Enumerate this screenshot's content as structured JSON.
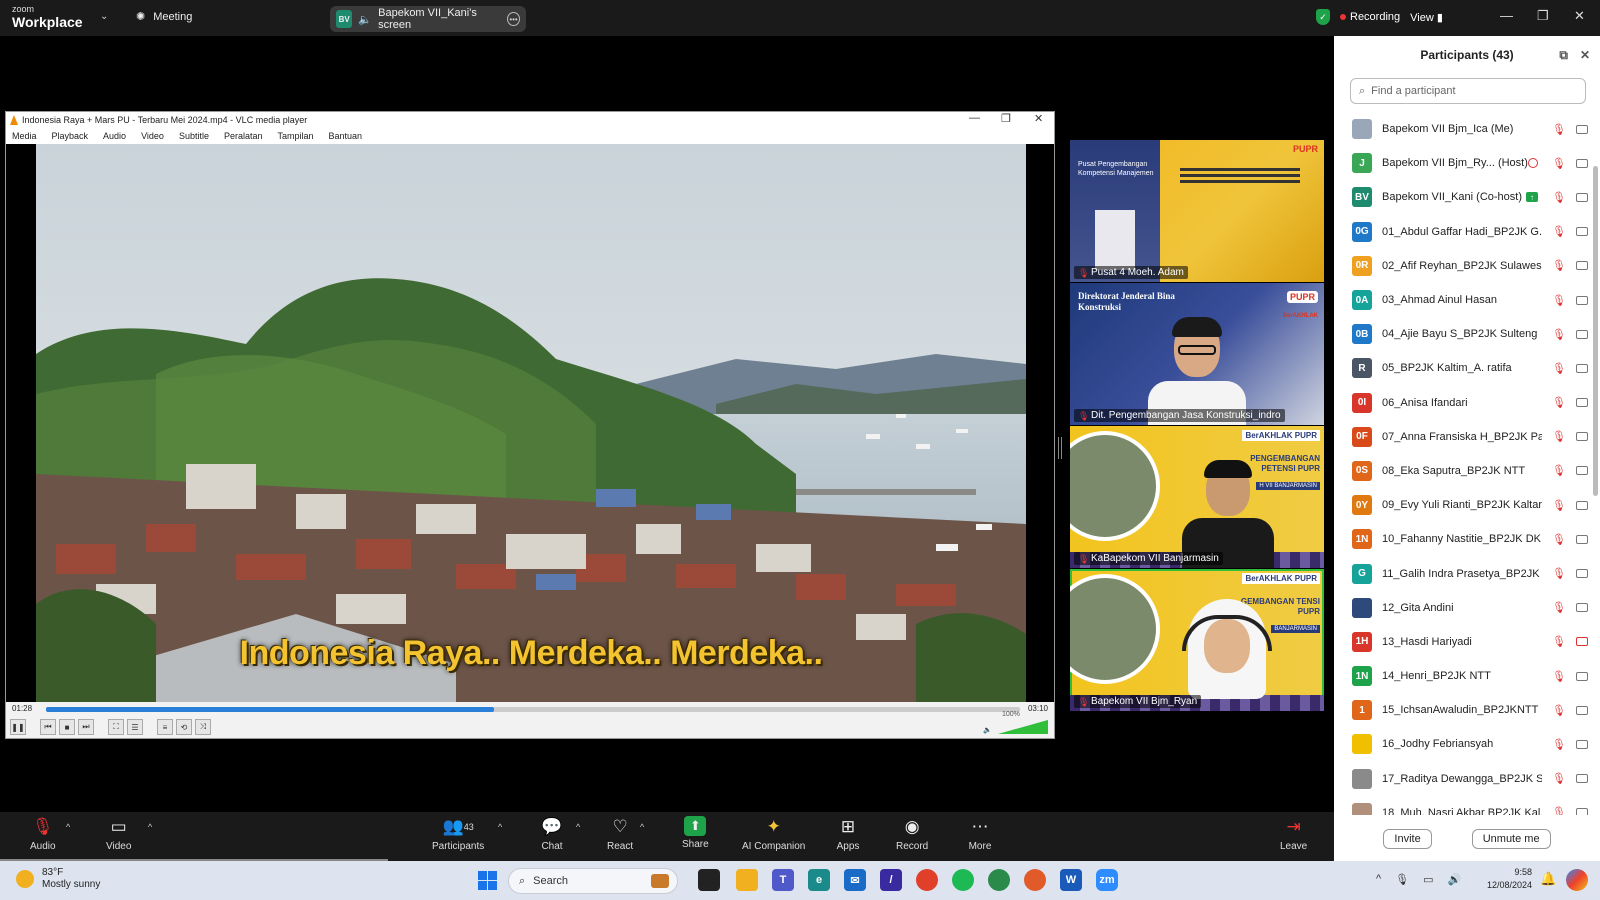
{
  "zoom": {
    "brand_top": "zoom",
    "brand_main": "Workplace",
    "meeting_label": "Meeting",
    "share_badge": "BV",
    "share_label": "Bapekom VII_Kani's screen",
    "recording_label": "Recording",
    "view_label": "View"
  },
  "vlc": {
    "title": "Indonesia Raya + Mars PU - Terbaru Mei 2024.mp4 - VLC media player",
    "menu": [
      "Media",
      "Playback",
      "Audio",
      "Video",
      "Subtitle",
      "Peralatan",
      "Tampilan",
      "Bantuan"
    ],
    "subtitle": "Indonesia Raya.. Merdeka.. Merdeka..",
    "time_current": "01:28",
    "time_total": "03:10",
    "progress": 0.46,
    "volume_label": "100%",
    "volume": 1.0
  },
  "tiles": [
    {
      "name": "Pusat 4 Moeh. Adam",
      "overlay": "Pusat Pengembangan Kompetensi Manajemen",
      "brand": "PUPR"
    },
    {
      "name": "Dit. Pengembangan Jasa Konstruksi_indro",
      "overlay": "Direktorat Jenderal Bina Konstruksi",
      "brand": "PUPR",
      "sub": "BerAKHLAK"
    },
    {
      "name": "KaBapekom VII Banjarmasin",
      "overlay": "PENGEMBANGAN PETENSI PUPR",
      "brand": "BerAKHLAK PUPR",
      "sub": "H VII BANJARMASIN"
    },
    {
      "name": "Bapekom VII Bjm_Ryan",
      "overlay": "GEMBANGAN TENSI PUPR",
      "brand": "BerAKHLAK PUPR",
      "sub": "BANJARMASIN"
    }
  ],
  "panel": {
    "title": "Participants (43)",
    "search_placeholder": "Find a participant",
    "invite": "Invite",
    "unmute_me": "Unmute me",
    "participants": [
      {
        "initials": "",
        "name": "Bapekom VII Bjm_Ica (Me)",
        "color": "#9aa7b8"
      },
      {
        "initials": "J",
        "name": "Bapekom VII Bjm_Ry... (Host)",
        "color": "#3aa757"
      },
      {
        "initials": "BV",
        "name": "Bapekom VII_Kani (Co-host)",
        "color": "#1e8b6f"
      },
      {
        "initials": "0G",
        "name": "01_Abdul Gaffar Hadi_BP2JK G...",
        "color": "#1f78c8"
      },
      {
        "initials": "0R",
        "name": "02_Afif Reyhan_BP2JK Sulawesi ...",
        "color": "#f0a020"
      },
      {
        "initials": "0A",
        "name": "03_Ahmad Ainul Hasan",
        "color": "#16a39a"
      },
      {
        "initials": "0B",
        "name": "04_Ajie Bayu S_BP2JK Sulteng",
        "color": "#1f78c8"
      },
      {
        "initials": "R",
        "name": "05_BP2JK Kaltim_A. ratifa",
        "color": "#4a5566"
      },
      {
        "initials": "0I",
        "name": "06_Anisa Ifandari",
        "color": "#d9362b"
      },
      {
        "initials": "0F",
        "name": "07_Anna Fransiska H_BP2JK Pa...",
        "color": "#d94a1a"
      },
      {
        "initials": "0S",
        "name": "08_Eka Saputra_BP2JK NTT",
        "color": "#e0661a"
      },
      {
        "initials": "0Y",
        "name": "09_Evy Yuli Rianti_BP2JK Kaltara",
        "color": "#e07a10"
      },
      {
        "initials": "1N",
        "name": "10_Fahanny Nastitie_BP2JK DKI",
        "color": "#e0661a"
      },
      {
        "initials": "G",
        "name": "11_Galih Indra Prasetya_BP2JK ...",
        "color": "#16a39a"
      },
      {
        "initials": "",
        "name": "12_Gita Andini",
        "color": "#2d4a7a"
      },
      {
        "initials": "1H",
        "name": "13_Hasdi Hariyadi",
        "color": "#d9362b"
      },
      {
        "initials": "1N",
        "name": "14_Henri_BP2JK NTT",
        "color": "#1fa34a"
      },
      {
        "initials": "1",
        "name": "15_IchsanAwaludin_BP2JKNTT",
        "color": "#e0661a"
      },
      {
        "initials": "",
        "name": "16_Jodhy Febriansyah",
        "color": "#f0c000"
      },
      {
        "initials": "",
        "name": "17_Raditya Dewangga_BP2JK S...",
        "color": "#8a8a8a"
      },
      {
        "initials": "",
        "name": "18_Muh. Nasri Akbar BP2JK Kal...",
        "color": "#b0907a"
      }
    ]
  },
  "toolbar": {
    "audio": "Audio",
    "video": "Video",
    "participants": "Participants",
    "participants_count": "43",
    "chat": "Chat",
    "react": "React",
    "share": "Share",
    "ai": "AI Companion",
    "apps": "Apps",
    "record": "Record",
    "more": "More",
    "leave": "Leave"
  },
  "taskbar": {
    "temp": "83°F",
    "weather": "Mostly sunny",
    "search": "Search",
    "time": "9:58",
    "date": "12/08/2024"
  }
}
